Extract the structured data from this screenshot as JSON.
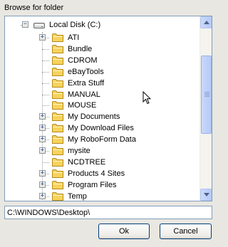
{
  "dialog": {
    "title": "Browse for folder"
  },
  "tree": {
    "root": {
      "label": "Local Disk (C:)",
      "icon": "drive-icon",
      "expanded": true
    },
    "items": [
      {
        "label": "ATI",
        "expandable": true
      },
      {
        "label": "Bundle",
        "expandable": false
      },
      {
        "label": "CDROM",
        "expandable": false
      },
      {
        "label": "eBayTools",
        "expandable": false
      },
      {
        "label": "Extra Stuff",
        "expandable": false
      },
      {
        "label": "MANUAL",
        "expandable": false
      },
      {
        "label": "MOUSE",
        "expandable": false
      },
      {
        "label": "My Documents",
        "expandable": true
      },
      {
        "label": "My Download Files",
        "expandable": true
      },
      {
        "label": "My RoboForm Data",
        "expandable": true
      },
      {
        "label": "mysite",
        "expandable": true
      },
      {
        "label": "NCDTREE",
        "expandable": false
      },
      {
        "label": "Products 4 Sites",
        "expandable": true
      },
      {
        "label": "Program Files",
        "expandable": true
      },
      {
        "label": "Temp",
        "expandable": true
      }
    ]
  },
  "path": {
    "value": "C:\\WINDOWS\\Desktop\\"
  },
  "buttons": {
    "ok_label": "Ok",
    "cancel_label": "Cancel"
  },
  "colors": {
    "dialog_bg": "#e9e7e1",
    "folder_yellow": "#f6d35e",
    "border_blue": "#7f9db9",
    "scroll_blue": "#b6caf6"
  }
}
